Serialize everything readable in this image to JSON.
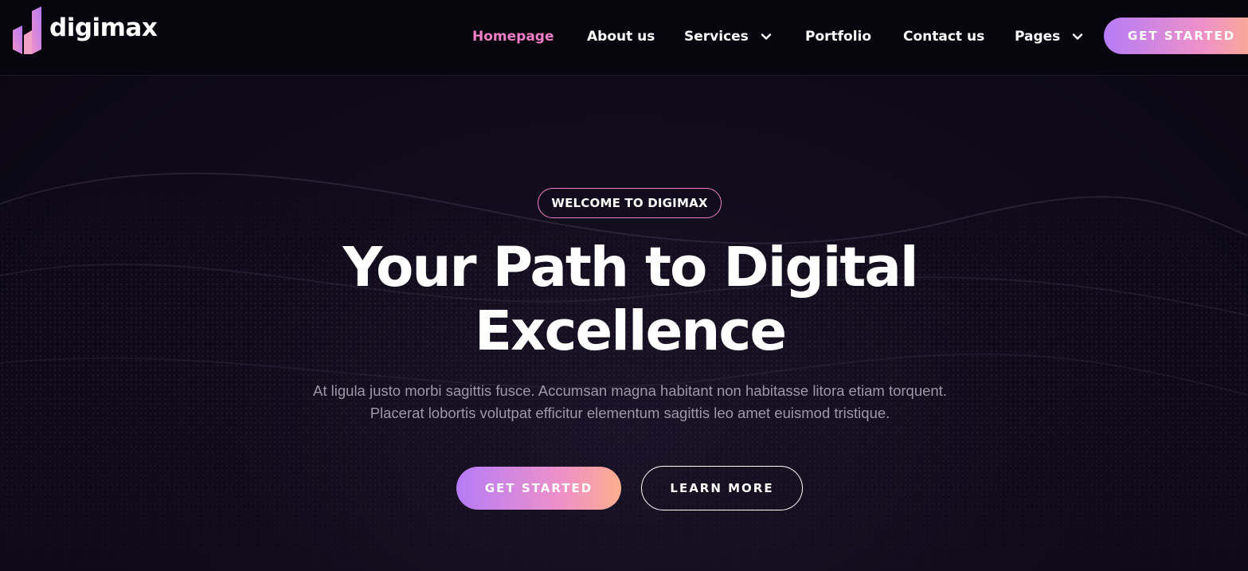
{
  "brand": {
    "name": "digimax",
    "accent": "#f17fc5",
    "gradient": [
      "#b57cf7",
      "#f091c7",
      "#fcae8e"
    ],
    "background": "#0b0814"
  },
  "nav": {
    "items": [
      {
        "label": "Homepage",
        "active": true
      },
      {
        "label": "About us"
      },
      {
        "label": "Services",
        "icon": "chevron-down-icon"
      },
      {
        "label": "Portfolio"
      },
      {
        "label": "Contact us"
      },
      {
        "label": "Pages",
        "icon": "chevron-down-icon"
      }
    ],
    "cta_label": "GET STARTED"
  },
  "hero": {
    "badge": "WELCOME TO DIGIMAX",
    "title_line1": "Your Path to Digital",
    "title_line2": "Excellence",
    "description": "At ligula justo morbi sagittis fusce. Accumsan magna habitant non habitasse litora etiam torquent. Placerat lobortis volutpat efficitur elementum sagittis leo amet euismod tristique.",
    "primary_label": "GET STARTED",
    "secondary_label": "LEARN MORE"
  }
}
